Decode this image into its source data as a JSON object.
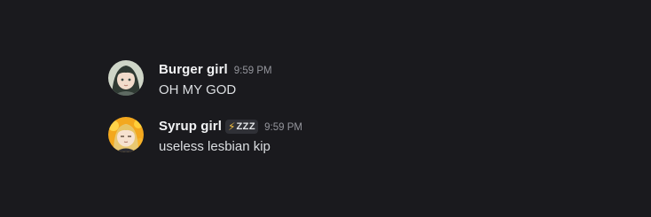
{
  "messages": [
    {
      "username": "Burger girl",
      "timestamp": "9:59 PM",
      "text": "OH MY GOD",
      "avatar_icon": "anime-girl-dark-hair-avatar"
    },
    {
      "username": "Syrup girl",
      "clan_tag": {
        "icon": "lightning-bolt-icon",
        "glyph": "⚡",
        "text": "ZZZ"
      },
      "timestamp": "9:59 PM",
      "text": "useless lesbian kip",
      "avatar_icon": "anime-girl-blonde-avatar"
    }
  ],
  "colors": {
    "background": "#1a1a1e",
    "username": "#f2f3f5",
    "message_text": "#dbdee1",
    "timestamp": "#94959c",
    "clan_tag_bg": "#2f3036",
    "clan_icon": "#f6c343"
  }
}
